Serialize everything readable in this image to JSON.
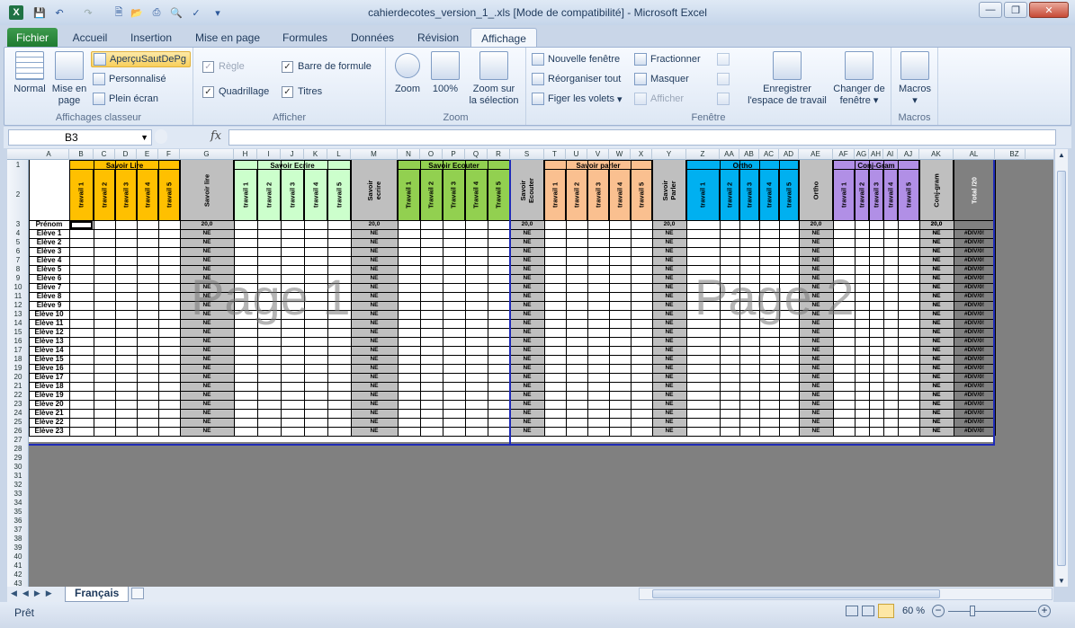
{
  "window": {
    "title": "cahierdecotes_version_1_.xls  [Mode de compatibilité]  -  Microsoft Excel"
  },
  "tabs": [
    "Fichier",
    "Accueil",
    "Insertion",
    "Mise en page",
    "Formules",
    "Données",
    "Révision",
    "Affichage"
  ],
  "ribbon": {
    "classeur": {
      "normal": "Normal",
      "miseenpage_1": "Mise en",
      "miseenpage_2": "page",
      "apercu": "AperçuSautDePg",
      "perso": "Personnalisé",
      "plein": "Plein écran",
      "label": "Affichages classeur"
    },
    "afficher": {
      "regle": "Règle",
      "quadrillage": "Quadrillage",
      "barre": "Barre de formule",
      "titres": "Titres",
      "label": "Afficher"
    },
    "zoom": {
      "zoom": "Zoom",
      "cent": "100%",
      "sel_1": "Zoom sur",
      "sel_2": "la sélection",
      "label": "Zoom"
    },
    "fenetre": {
      "nouvelle": "Nouvelle fenêtre",
      "reorg": "Réorganiser tout",
      "figer": "Figer les volets",
      "fract": "Fractionner",
      "masquer": "Masquer",
      "afficher": "Afficher",
      "enreg_1": "Enregistrer",
      "enreg_2": "l'espace de travail",
      "changer_1": "Changer de",
      "changer_2": "fenêtre",
      "label": "Fenêtre"
    },
    "macros": {
      "macros": "Macros",
      "label": "Macros"
    }
  },
  "formula": {
    "namebox": "B3",
    "fx": "fx"
  },
  "columns": [
    "A",
    "B",
    "C",
    "D",
    "E",
    "F",
    "G",
    "H",
    "I",
    "J",
    "K",
    "L",
    "M",
    "N",
    "O",
    "P",
    "Q",
    "R",
    "S",
    "T",
    "U",
    "V",
    "W",
    "X",
    "Y",
    "Z",
    "AA",
    "AB",
    "AC",
    "AD",
    "AE",
    "AF",
    "AG",
    "AH",
    "AI",
    "AJ",
    "AK",
    "AL",
    "BZ"
  ],
  "rows": [
    "1",
    "2",
    "3",
    "4",
    "5",
    "6",
    "7",
    "8",
    "9",
    "10",
    "11",
    "12",
    "13",
    "14",
    "15",
    "16",
    "17",
    "18",
    "19",
    "20",
    "21",
    "22",
    "23",
    "24",
    "25",
    "26",
    "27",
    "28",
    "29",
    "30",
    "31",
    "32",
    "33",
    "34",
    "35",
    "36",
    "37",
    "38",
    "39",
    "40",
    "41",
    "42",
    "43"
  ],
  "groups": [
    "Savoir Lire",
    "Savoir Ecrire",
    "Savoir Ecouter",
    "Savoir parler",
    "Ortho",
    "Conj-Gram"
  ],
  "headers": {
    "lire": [
      "travail 1",
      "travail 2",
      "travail 3",
      "travail 4",
      "travail 5"
    ],
    "lire_total": "Savoir lire",
    "ecrire": [
      "travail 1",
      "travail 2",
      "travail 3",
      "travail 4",
      "travail 5"
    ],
    "ecrire_total": "Savoir ecrire",
    "ecouter": [
      "Travail 1",
      "Travail 2",
      "Travail 3",
      "Travail 4",
      "Travail 5"
    ],
    "ecouter_total": "Savoir Ecouter",
    "parler": [
      "travail 1",
      "travail 2",
      "travail 3",
      "travail 4",
      "travail 5"
    ],
    "parler_total": "Savoir Parler",
    "ortho": [
      "travail 1",
      "travail 2",
      "travail 3",
      "travail 4",
      "travail 5"
    ],
    "ortho_total": "Ortho",
    "conj": [
      "travail 1",
      "travail 2",
      "travail 3",
      "travail 4",
      "travail 5"
    ],
    "conj_total": "Conj-gram",
    "total": "Total /20"
  },
  "students": [
    "Prénom",
    "Elève 1",
    "Elève 2",
    "Elève 3",
    "Elève 4",
    "Elève 5",
    "Elève 6",
    "Elève 7",
    "Elève 8",
    "Elève 9",
    "Elève 10",
    "Elève 11",
    "Elève 12",
    "Elève 13",
    "Elève 14",
    "Elève 15",
    "Elève 16",
    "Elève 17",
    "Elève 18",
    "Elève 19",
    "Elève 20",
    "Elève 21",
    "Elève 22",
    "Elève 23"
  ],
  "values": {
    "max": "20,0",
    "ne": "NE",
    "div": "#DIV/0!"
  },
  "watermarks": [
    "Page 1",
    "Page 2"
  ],
  "sheet_tab": "Français",
  "status": {
    "ready": "Prêt",
    "zoom": "60 %"
  }
}
